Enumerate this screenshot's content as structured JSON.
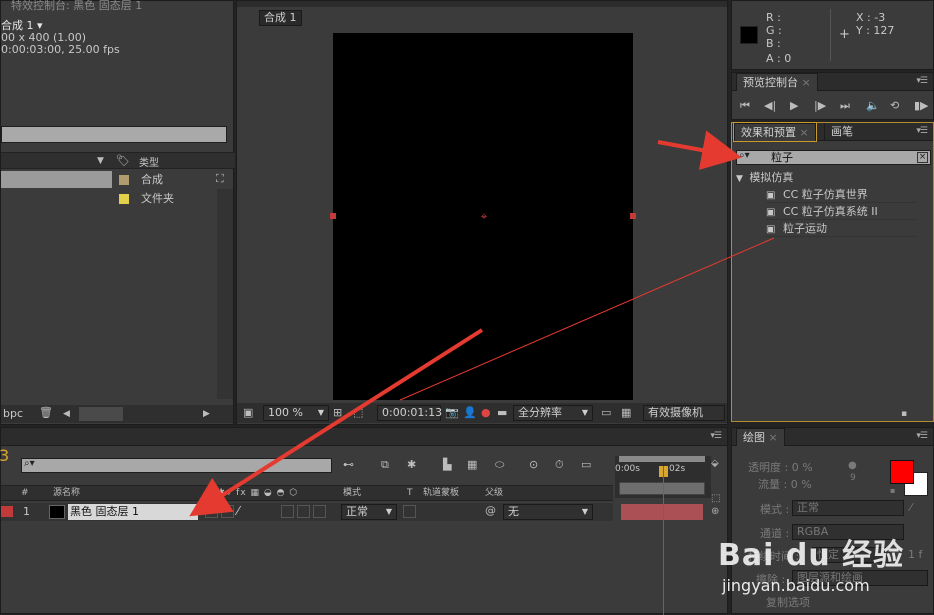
{
  "project": {
    "header_text": "特效控制台: 黑色 固态层 1",
    "comp_name": "合成 1 ▾",
    "size_info": "00 x 400 (1.00)",
    "duration_info": "0:00:03:00, 25.00 fps",
    "type_column": "类型",
    "items": [
      {
        "type": "合成",
        "color": "#b19c6f"
      },
      {
        "type": "文件夹",
        "color": "#e3cf4a"
      }
    ],
    "bpc": "bpc"
  },
  "viewer": {
    "tab_label": "合成 1",
    "zoom": "100 %",
    "timecode": "0:00:01:13",
    "resolution": "全分辨率",
    "camera": "有效摄像机"
  },
  "info": {
    "r": "R :",
    "g": "G :",
    "b": "B :",
    "a": "A : 0",
    "x": "X : -3",
    "y": "Y : 127"
  },
  "preview": {
    "tab": "预览控制台"
  },
  "effects": {
    "tab": "效果和预置",
    "tab2": "画笔",
    "search_value": "粒子",
    "category": "模拟仿真",
    "results": [
      "CC 粒子仿真世界",
      "CC 粒子仿真系统 II",
      "粒子运动"
    ]
  },
  "paint": {
    "tab": "绘图",
    "opacity": "透明度 : 0 %",
    "flow": "流量 : 0 %",
    "brush_size": "9",
    "mode_label": "模式 :",
    "mode_value": "正常",
    "channel_label": "通道 :",
    "channel_value": "RGBA",
    "duration_label": "持续时间 :",
    "duration_value": "恒定",
    "frame": "1 f",
    "erase_label": "擦除 :",
    "erase_value": "图层源和绘画",
    "clone_label": "复制选项",
    "fg_color": "#ff0000",
    "bg_color": "#ffffff"
  },
  "timeline": {
    "col_num": "#",
    "col_name": "源名称",
    "col_mode": "模式",
    "col_t": "T",
    "col_matte": "轨道蒙板",
    "col_parent": "父级",
    "layer_num": "1",
    "layer_name": "黑色 固态层 1",
    "layer_mode": "正常",
    "layer_parent": "无",
    "ruler_0": "0:00s",
    "ruler_2": "02s",
    "layer_color": "#c33a3a"
  },
  "watermark": {
    "brand": "Bai du 经验",
    "url": "jingyan.baidu.com"
  }
}
